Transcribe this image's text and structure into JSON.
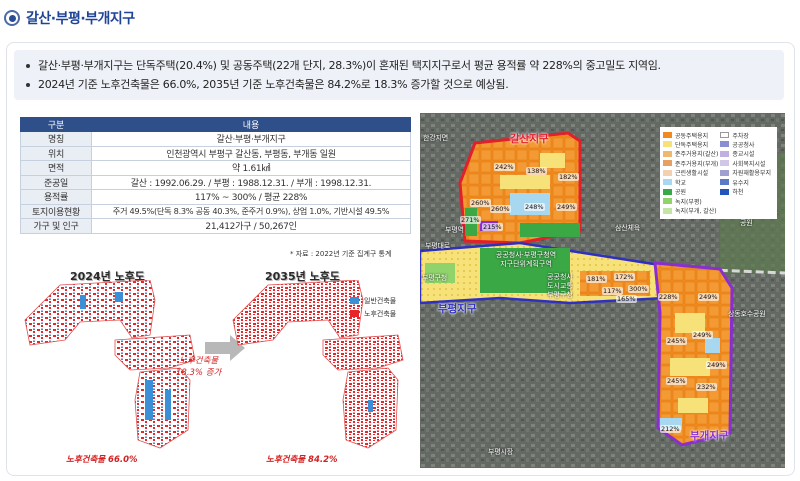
{
  "header": {
    "title": "갈산·부평·부개지구"
  },
  "summary": [
    "갈산·부평·부개지구는 단독주택(20.4%) 및 공동주택(22개 단지, 28.3%)이 혼재된 택지지구로서 평균 용적률 약 228%의 중고밀도 지역임.",
    "2024년 기준 노후건축물은 66.0%, 2035년 기준 노후건축물은 84.2%로 18.3% 증가할 것으로 예상됨."
  ],
  "table": {
    "headers": [
      "구분",
      "내용"
    ],
    "rows": [
      [
        "명칭",
        "갈산·부평·부개지구"
      ],
      [
        "위치",
        "인천광역시 부평구 갈산동, 부평동, 부개동 일원"
      ],
      [
        "면적",
        "약 1.61㎢"
      ],
      [
        "준공일",
        "갈산 : 1992.06.29. / 부평 : 1988.12.31. / 부개 : 1998.12.31."
      ],
      [
        "용적률",
        "117% ~ 300% / 평균 228%"
      ],
      [
        "토지이용현황",
        "주거 49.5%(단독 8.3% 공동 40.3%, 준주거 0.9%), 상업 1.0%, 기반시설 49.5%"
      ],
      [
        "가구 및 인구",
        "21,412가구 / 50,267인"
      ]
    ],
    "note": "* 자료 : 2022년 기준 집계구 통계"
  },
  "maps_left": {
    "title_2024": "2024년 노후도",
    "title_2035": "2035년 노후도",
    "legend": [
      {
        "label": "일반건축물",
        "color": "#3b8fd6"
      },
      {
        "label": "노후건축물",
        "color": "#e8262a"
      }
    ],
    "increase": [
      "노후건축물",
      "18.3% 증가"
    ],
    "rate_2024": "노후건축물 66.0%",
    "rate_2035": "노후건축물 84.2%"
  },
  "map_right": {
    "districts": [
      "갈산지구",
      "부평지구",
      "부개지구"
    ],
    "roads": [
      "한강지면",
      "부평대로",
      "부평역",
      "부평구청",
      "삼산체육",
      "부평시민문화공원",
      "상동호수공원",
      "부평시장",
      "부평대로"
    ],
    "center_labels": [
      "공공청사·부평구청역",
      "지구단위계획구역",
      "공공청사",
      "도시교통",
      "부평구청"
    ],
    "pcts_galsan": [
      "242%",
      "138%",
      "182%",
      "260%",
      "248%",
      "249%",
      "260%",
      "271%",
      "215%"
    ],
    "pcts_bupyeong": [
      "181%",
      "172%",
      "117%",
      "300%",
      "165%"
    ],
    "pcts_bugae": [
      "228%",
      "249%",
      "249%",
      "245%",
      "249%",
      "245%",
      "232%",
      "212%"
    ],
    "legend": [
      {
        "label": "공동주택용지",
        "color": "#f08a1e"
      },
      {
        "label": "주차장",
        "color": "#ffffff"
      },
      {
        "label": "단독주택용지",
        "color": "#f7e27a"
      },
      {
        "label": "공공청사",
        "color": "#8a8fd2"
      },
      {
        "label": "준주거용지(갈산)",
        "color": "#f0b86e"
      },
      {
        "label": "종교시설",
        "color": "#bfb0e0"
      },
      {
        "label": "준주거용지(부개)",
        "color": "#e8a060"
      },
      {
        "label": "사회복지시설",
        "color": "#d0c6e8"
      },
      {
        "label": "근린생활시설",
        "color": "#f2d0b0"
      },
      {
        "label": "자원재활용부지",
        "color": "#a0a0d0"
      },
      {
        "label": "학교",
        "color": "#a8d8f0"
      },
      {
        "label": "유수지",
        "color": "#5a7ac8"
      },
      {
        "label": "공원",
        "color": "#3aa845"
      },
      {
        "label": "하천",
        "color": "#2255bb"
      },
      {
        "label": "녹지(부평)",
        "color": "#8fd36a"
      },
      {
        "label": "",
        "color": ""
      },
      {
        "label": "녹지(부개, 갈산)",
        "color": "#c4e4a6"
      }
    ]
  }
}
